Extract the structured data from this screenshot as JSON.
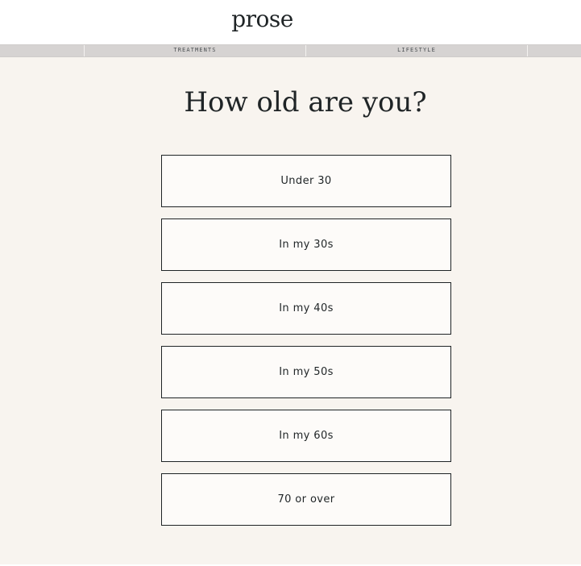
{
  "header": {
    "logo": "prose"
  },
  "progress": {
    "steps": [
      {
        "label": ""
      },
      {
        "label": "TREATMENTS"
      },
      {
        "label": "LIFESTYLE"
      },
      {
        "label": ""
      }
    ]
  },
  "question": "How old are you?",
  "options": [
    {
      "label": "Under 30"
    },
    {
      "label": "In my 30s"
    },
    {
      "label": "In my 40s"
    },
    {
      "label": "In my 50s"
    },
    {
      "label": "In my 60s"
    },
    {
      "label": "70 or over"
    }
  ]
}
